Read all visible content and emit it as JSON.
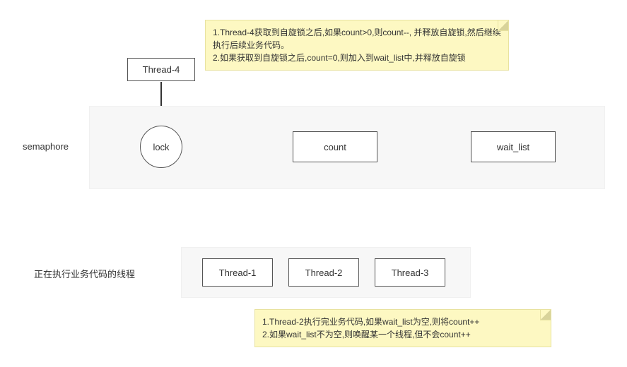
{
  "thread4": {
    "label": "Thread-4"
  },
  "note_top": {
    "line1": "1.Thread-4获取到自旋锁之后,如果count>0,则count--, 并释放自旋锁,然后继续执行后续业务代码。",
    "line2": "2.如果获取到自旋锁之后,count=0,则加入到wait_list中,并释放自旋锁"
  },
  "semaphore": {
    "label": "semaphore",
    "lock": "lock",
    "count": "count",
    "wait_list": "wait_list"
  },
  "running": {
    "label": "正在执行业务代码的线程",
    "threads": [
      "Thread-1",
      "Thread-2",
      "Thread-3"
    ]
  },
  "note_bottom": {
    "line1": "1.Thread-2执行完业务代码,如果wait_list为空,则将count++",
    "line2": "2.如果wait_list不为空,则唤醒某一个线程,但不会count++"
  }
}
